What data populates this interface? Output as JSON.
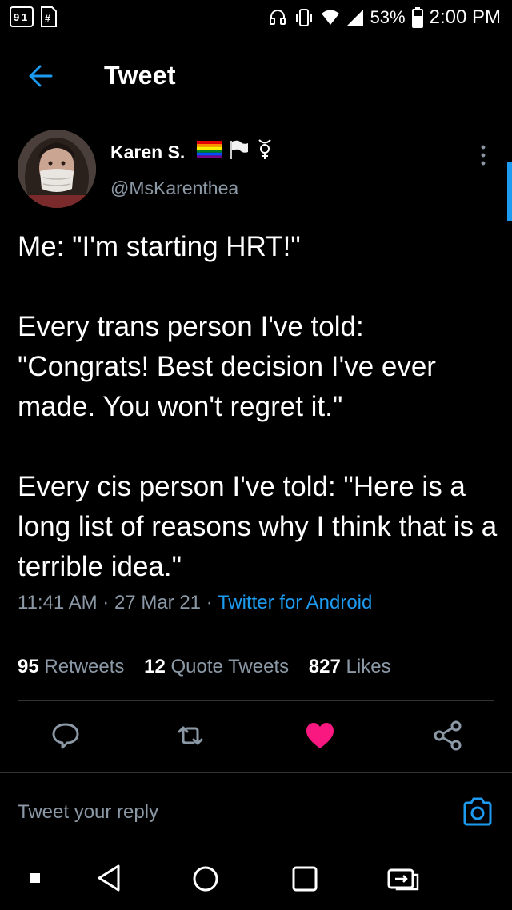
{
  "status_bar": {
    "battery": "53%",
    "time": "2:00 PM"
  },
  "header": {
    "title": "Tweet"
  },
  "tweet": {
    "author_name": "Karen S.",
    "author_handle": "@MsKarenthea",
    "text": "Me: \"I'm starting HRT!\"\n\nEvery trans person I've told: \"Congrats! Best decision I've ever made. You won't regret it.\"\n\nEvery cis person I've told: \"Here is a long list of reasons why I think that is a terrible idea.\"",
    "time": "11:41 AM",
    "date": "27 Mar 21",
    "separator": "·",
    "source": "Twitter for Android"
  },
  "stats": {
    "retweets_count": "95",
    "retweets_label": "Retweets",
    "quotes_count": "12",
    "quotes_label": "Quote Tweets",
    "likes_count": "827",
    "likes_label": "Likes"
  },
  "actions": [
    "reply-icon",
    "retweet-icon",
    "heart-icon",
    "share-icon"
  ],
  "reply_box": {
    "placeholder": "Tweet your reply"
  },
  "colors": {
    "background": "#000000",
    "accent": "#1d9bf0",
    "like": "#f91880",
    "muted": "#8b98a5"
  }
}
